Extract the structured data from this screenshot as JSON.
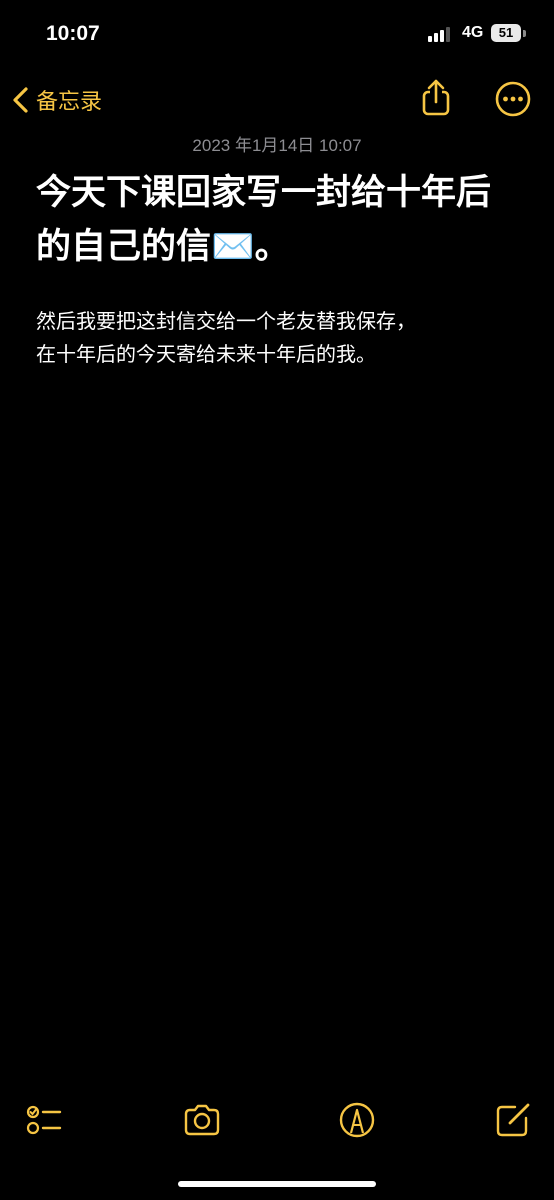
{
  "status_bar": {
    "time": "10:07",
    "network": "4G",
    "battery_level": "51",
    "signal_icon": "signal-bars-icon",
    "battery_icon": "battery-icon"
  },
  "nav": {
    "back_label": "备忘录",
    "back_icon": "chevron-left-icon",
    "share_icon": "share-icon",
    "more_icon": "ellipsis-circle-icon",
    "accent_color": "#f6c544"
  },
  "note": {
    "date": "2023 年1月14日 10:07",
    "title": "今天下课回家写一封给十年后的自己的信✉️。",
    "body_line1": "然后我要把这封信交给一个老友替我保存，",
    "body_line2": "在十年后的今天寄给未来十年后的我。"
  },
  "toolbar": {
    "checklist_icon": "checklist-icon",
    "camera_icon": "camera-icon",
    "markup_icon": "markup-pen-icon",
    "compose_icon": "compose-icon"
  },
  "colors": {
    "background": "#000000",
    "text": "#ffffff",
    "secondary_text": "#8d8d92",
    "accent": "#f6c544"
  }
}
